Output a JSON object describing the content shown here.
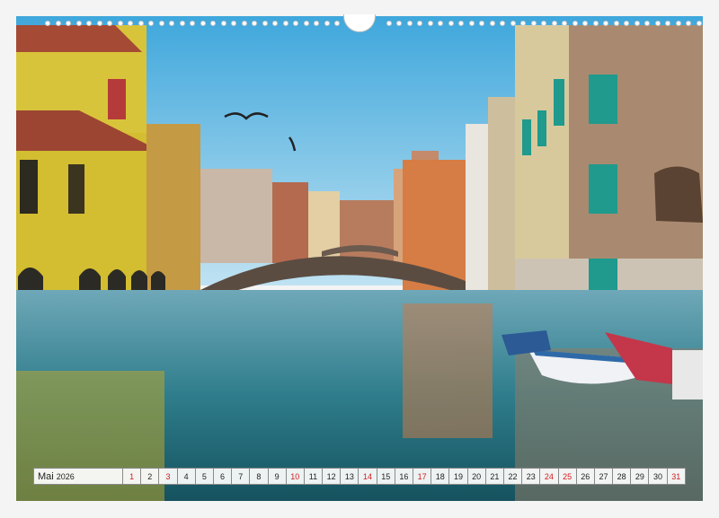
{
  "calendar": {
    "month": "Mai",
    "year": "2026",
    "days": [
      {
        "n": "1",
        "red": true
      },
      {
        "n": "2",
        "red": false
      },
      {
        "n": "3",
        "red": true
      },
      {
        "n": "4",
        "red": false
      },
      {
        "n": "5",
        "red": false
      },
      {
        "n": "6",
        "red": false
      },
      {
        "n": "7",
        "red": false
      },
      {
        "n": "8",
        "red": false
      },
      {
        "n": "9",
        "red": false
      },
      {
        "n": "10",
        "red": true
      },
      {
        "n": "11",
        "red": false
      },
      {
        "n": "12",
        "red": false
      },
      {
        "n": "13",
        "red": false
      },
      {
        "n": "14",
        "red": true
      },
      {
        "n": "15",
        "red": false
      },
      {
        "n": "16",
        "red": false
      },
      {
        "n": "17",
        "red": true
      },
      {
        "n": "18",
        "red": false
      },
      {
        "n": "19",
        "red": false
      },
      {
        "n": "20",
        "red": false
      },
      {
        "n": "21",
        "red": false
      },
      {
        "n": "22",
        "red": false
      },
      {
        "n": "23",
        "red": false
      },
      {
        "n": "24",
        "red": true
      },
      {
        "n": "25",
        "red": true
      },
      {
        "n": "26",
        "red": false
      },
      {
        "n": "27",
        "red": false
      },
      {
        "n": "28",
        "red": false
      },
      {
        "n": "29",
        "red": false
      },
      {
        "n": "30",
        "red": false
      },
      {
        "n": "31",
        "red": true
      }
    ],
    "colors": {
      "weekday": "#222222",
      "sunday_holiday": "#d21b1b"
    }
  }
}
